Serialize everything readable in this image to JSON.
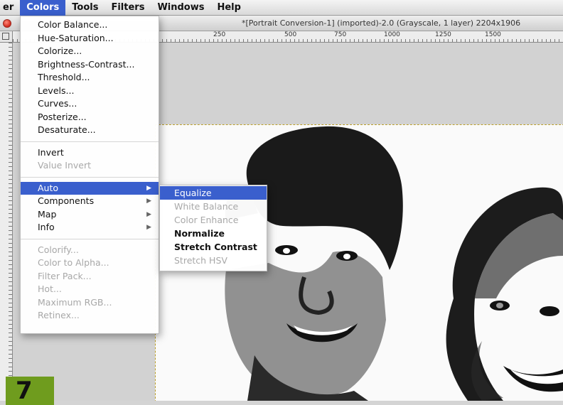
{
  "menubar": {
    "items": [
      {
        "label": "er",
        "active": false
      },
      {
        "label": "Colors",
        "active": true
      },
      {
        "label": "Tools",
        "active": false
      },
      {
        "label": "Filters",
        "active": false
      },
      {
        "label": "Windows",
        "active": false
      },
      {
        "label": "Help",
        "active": false
      }
    ]
  },
  "document": {
    "title": "*[Portrait Conversion-1] (imported)-2.0 (Grayscale, 1 layer) 2204x1906"
  },
  "ruler": {
    "top_labels": [
      "250",
      "500",
      "750",
      "1000",
      "1250",
      "1500"
    ]
  },
  "colors_menu": {
    "group1": [
      "Color Balance...",
      "Hue-Saturation...",
      "Colorize...",
      "Brightness-Contrast...",
      "Threshold...",
      "Levels...",
      "Curves...",
      "Posterize...",
      "Desaturate..."
    ],
    "group2": [
      {
        "label": "Invert",
        "disabled": false
      },
      {
        "label": "Value Invert",
        "disabled": true
      }
    ],
    "group3": [
      {
        "label": "Auto",
        "highlighted": true
      },
      {
        "label": "Components",
        "highlighted": false
      },
      {
        "label": "Map",
        "highlighted": false
      },
      {
        "label": "Info",
        "highlighted": false
      }
    ],
    "group4": [
      "Colorify...",
      "Color to Alpha...",
      "Filter Pack...",
      "Hot...",
      "Maximum RGB...",
      "Retinex..."
    ]
  },
  "auto_submenu": {
    "items": [
      {
        "label": "Equalize",
        "state": "highlighted"
      },
      {
        "label": "White Balance",
        "state": "disabled"
      },
      {
        "label": "Color Enhance",
        "state": "disabled"
      },
      {
        "label": "Normalize",
        "state": "enabled"
      },
      {
        "label": "Stretch Contrast",
        "state": "enabled"
      },
      {
        "label": "Stretch HSV",
        "state": "disabled"
      }
    ]
  },
  "step_badge": "7",
  "colors": {
    "highlight": "#3a5fcd",
    "badge": "#6f9c1e"
  },
  "icons": {
    "submenu_arrow": "▶"
  }
}
